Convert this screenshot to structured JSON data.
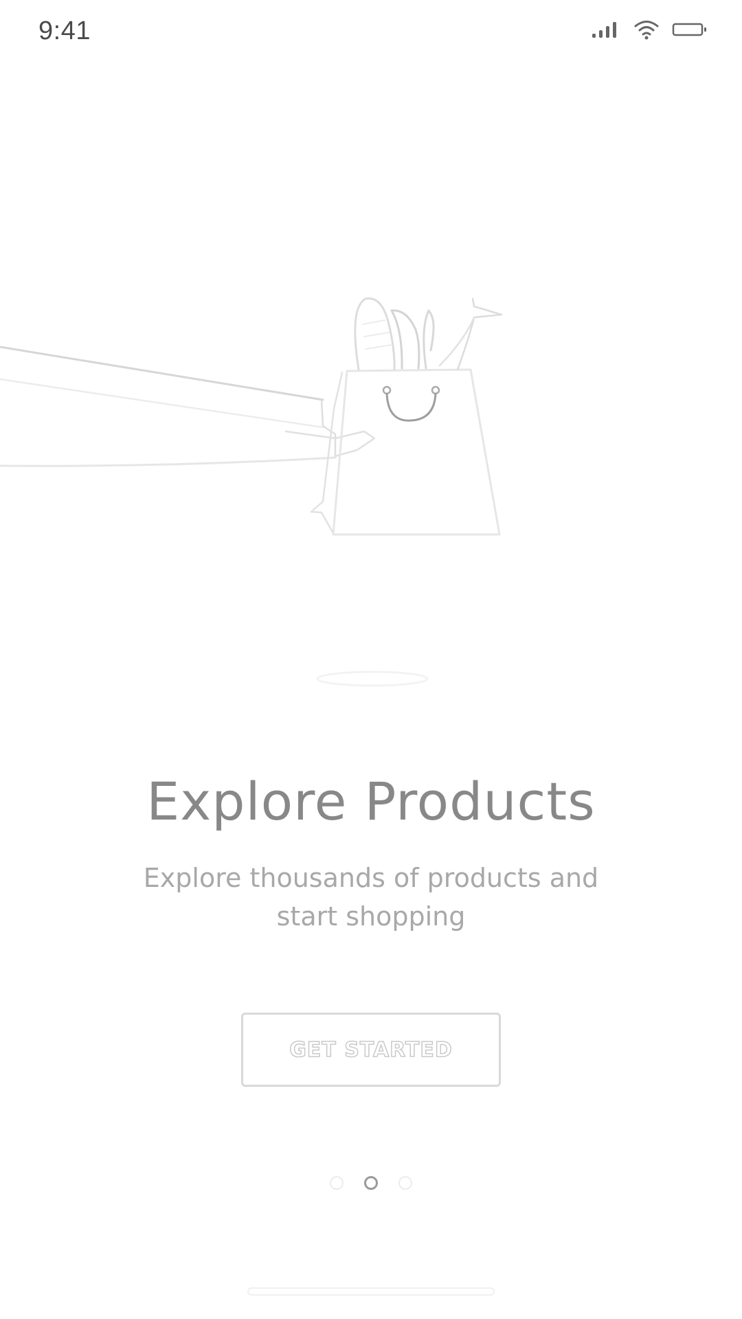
{
  "status_bar": {
    "time": "9:41",
    "icons": [
      "cellular-signal-icon",
      "wifi-icon",
      "battery-icon"
    ]
  },
  "illustration": {
    "icon": "shopping-bag-handoff-illustration"
  },
  "onboarding": {
    "title": "Explore Products",
    "subtitle": "Explore thousands of products and start shopping",
    "cta_label": "GET STARTED"
  },
  "pagination": {
    "current_page": 2,
    "total_pages": 3
  },
  "colors": {
    "title": "#888888",
    "subtitle": "#a8a8a8",
    "button_border": "#d9d9d9",
    "dot_active": "#9a9a9a"
  }
}
